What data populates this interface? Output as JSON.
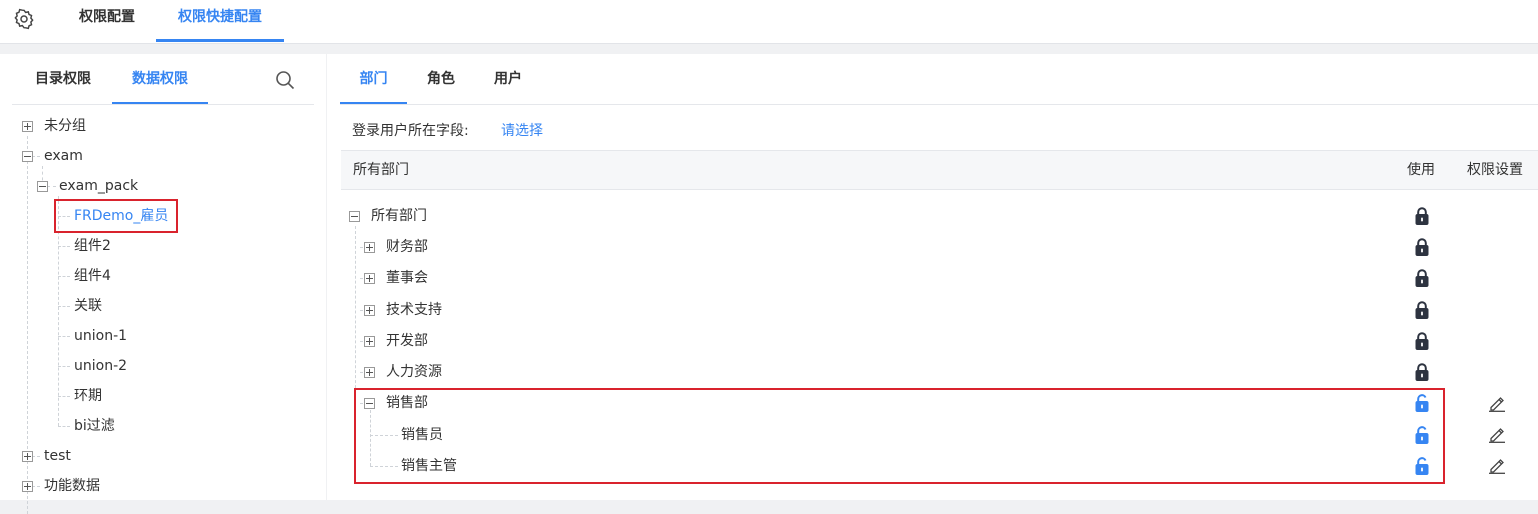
{
  "header": {
    "tabs": [
      {
        "label": "权限配置",
        "active": false
      },
      {
        "label": "权限快捷配置",
        "active": true
      }
    ]
  },
  "left": {
    "tabs": [
      {
        "label": "目录权限",
        "active": false
      },
      {
        "label": "数据权限",
        "active": true
      }
    ],
    "tree": [
      {
        "label": "未分组",
        "expand": "plus"
      },
      {
        "label": "exam",
        "expand": "minus"
      },
      {
        "label": "exam_pack",
        "expand": "minus"
      },
      {
        "label": "FRDemo_雇员",
        "selected": true
      },
      {
        "label": "组件2"
      },
      {
        "label": "组件4"
      },
      {
        "label": "关联"
      },
      {
        "label": "union-1"
      },
      {
        "label": "union-2"
      },
      {
        "label": "环期"
      },
      {
        "label": "bi过滤"
      },
      {
        "label": "test",
        "expand": "plus"
      },
      {
        "label": "功能数据",
        "expand": "plus"
      }
    ]
  },
  "right": {
    "tabs": [
      {
        "label": "部门",
        "active": true
      },
      {
        "label": "角色",
        "active": false
      },
      {
        "label": "用户",
        "active": false
      }
    ],
    "field_label": "登录用户所在字段:",
    "field_value": "请选择",
    "columns": {
      "name": "所有部门",
      "use": "使用",
      "permission": "权限设置"
    },
    "rows": [
      {
        "label": "所有部门",
        "expand": "minus",
        "use": "locked"
      },
      {
        "label": "财务部",
        "expand": "plus",
        "use": "locked"
      },
      {
        "label": "董事会",
        "expand": "plus",
        "use": "locked"
      },
      {
        "label": "技术支持",
        "expand": "plus",
        "use": "locked"
      },
      {
        "label": "开发部",
        "expand": "plus",
        "use": "locked"
      },
      {
        "label": "人力资源",
        "expand": "plus",
        "use": "locked"
      },
      {
        "label": "销售部",
        "expand": "minus",
        "use": "unlocked",
        "edit": true
      },
      {
        "label": "销售员",
        "use": "unlocked",
        "edit": true
      },
      {
        "label": "销售主管",
        "use": "unlocked",
        "edit": true
      }
    ]
  },
  "icons": {
    "settings": "gear-icon",
    "search": "search-icon",
    "locked": "lock-closed-icon",
    "unlocked": "lock-open-icon",
    "edit": "pencil-icon",
    "expand": "plus-box-icon",
    "collapse": "minus-box-icon"
  },
  "colors": {
    "accent": "#3685f2",
    "highlight_border": "#d9232d",
    "lock_dark": "#2d3340"
  }
}
